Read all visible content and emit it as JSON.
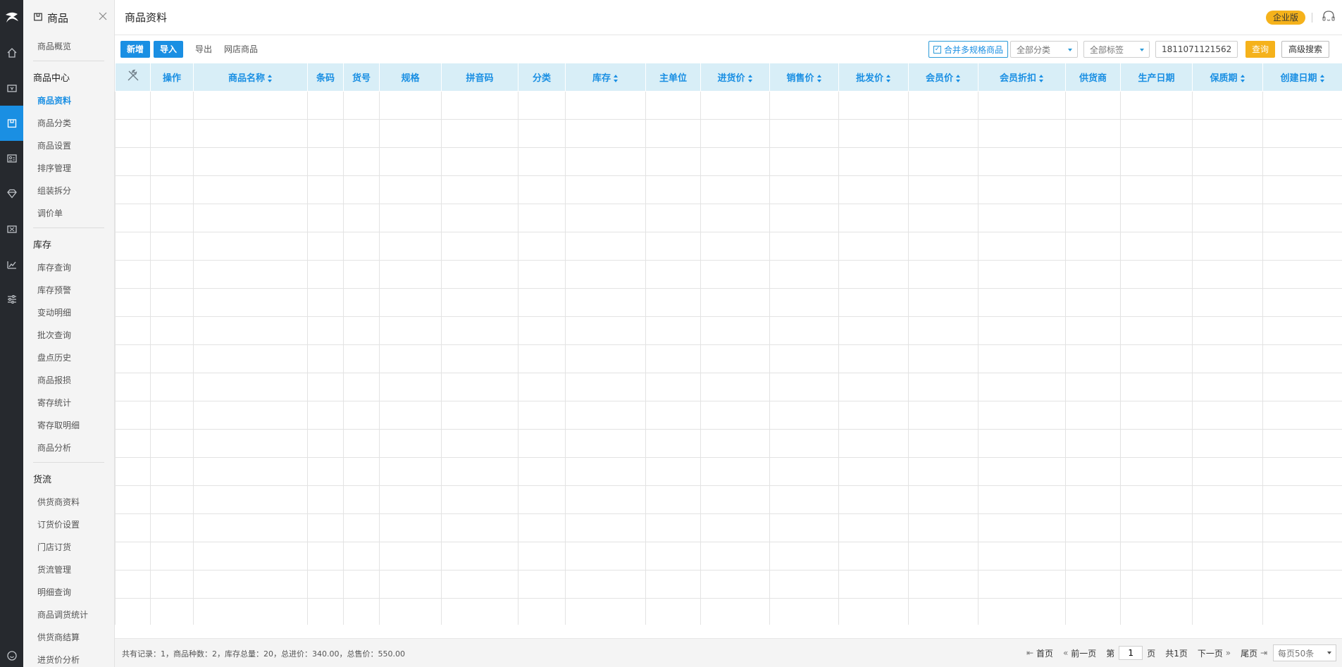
{
  "sidebar": {
    "module_title": "商品",
    "items_top": [
      "商品概览"
    ],
    "groups": [
      {
        "title": "商品中心",
        "items": [
          "商品资料",
          "商品分类",
          "商品设置",
          "排序管理",
          "组装拆分",
          "调价单"
        ]
      },
      {
        "title": "库存",
        "items": [
          "库存查询",
          "库存预警",
          "变动明细",
          "批次查询",
          "盘点历史",
          "商品报损",
          "寄存统计",
          "寄存取明细",
          "商品分析"
        ]
      },
      {
        "title": "货流",
        "items": [
          "供货商资料",
          "订货价设置",
          "门店订货",
          "货流管理",
          "明细查询",
          "商品调货统计",
          "供货商结算",
          "进货价分析"
        ]
      }
    ],
    "active_item": "商品资料"
  },
  "header": {
    "title": "商品资料",
    "edition_badge": "企业版"
  },
  "toolbar": {
    "add_label": "新增",
    "import_label": "导入",
    "export_label": "导出",
    "online_store_label": "网店商品",
    "merge_checkbox_label": "合并多规格商品",
    "merge_checked": true,
    "category_select": "全部分类",
    "tag_select": "全部标签",
    "search_value": "1811071121562",
    "query_label": "查询",
    "advanced_search_label": "高级搜索"
  },
  "table": {
    "columns": [
      "",
      "操作",
      "商品名称",
      "条码",
      "货号",
      "规格",
      "拼音码",
      "分类",
      "库存",
      "主单位",
      "进货价",
      "销售价",
      "批发价",
      "会员价",
      "会员折扣",
      "供货商",
      "生产日期",
      "保质期",
      "创建日期"
    ],
    "sortable": [
      false,
      false,
      true,
      false,
      false,
      false,
      false,
      false,
      true,
      false,
      true,
      true,
      true,
      true,
      true,
      false,
      false,
      true,
      true
    ],
    "empty_rows": 19
  },
  "footer": {
    "summary": "共有记录：1，商品种数：2，库存总量：20，总进价：340.00，总售价：550.00",
    "first_label": "首页",
    "prev_label": "前一页",
    "page_prefix": "第",
    "page_value": "1",
    "page_suffix": "页",
    "total_pages": "共1页",
    "next_label": "下一页",
    "last_label": "尾页",
    "per_page": "每页50条"
  },
  "colors": {
    "accent": "#1a8fe3",
    "rail": "#26292e",
    "header_bg": "#d8eef7",
    "badge": "#f5b21b"
  },
  "icons": [
    "logo-icon",
    "home-icon",
    "cashier-icon",
    "goods-icon",
    "member-icon",
    "diamond-icon",
    "coupon-icon",
    "chart-icon",
    "settings-icon",
    "power-icon",
    "close-icon",
    "headset-icon",
    "wrench-icon"
  ]
}
